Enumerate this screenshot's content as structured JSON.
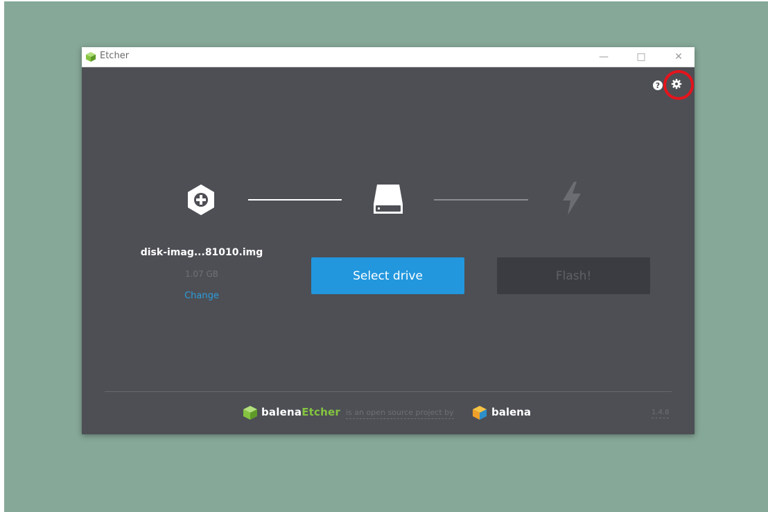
{
  "window": {
    "title": "Etcher",
    "controls": {
      "minimize": "—",
      "maximize": "□",
      "close": "✕"
    }
  },
  "toolbar": {
    "help_icon": "help-icon",
    "settings_icon": "gear-icon",
    "highlight_color": "#e5141c"
  },
  "steps": {
    "image": {
      "icon": "plus-hexagon-icon",
      "file_name": "disk-imag...81010.img",
      "file_size": "1.07 GB",
      "change_label": "Change"
    },
    "drive": {
      "icon": "drive-icon",
      "button_label": "Select drive"
    },
    "flash": {
      "icon": "lightning-icon",
      "button_label": "Flash!"
    }
  },
  "footer": {
    "brand_prefix": "balena",
    "brand_product": "Etcher",
    "tagline": "is an open source project by",
    "company": "balena",
    "version": "1.4.8"
  },
  "colors": {
    "background": "#86a898",
    "window_body": "#4d4f55",
    "primary_button": "#2297de",
    "disabled_button": "#3a3c41",
    "link": "#2d9cdb",
    "etcher_green": "#85c440"
  }
}
